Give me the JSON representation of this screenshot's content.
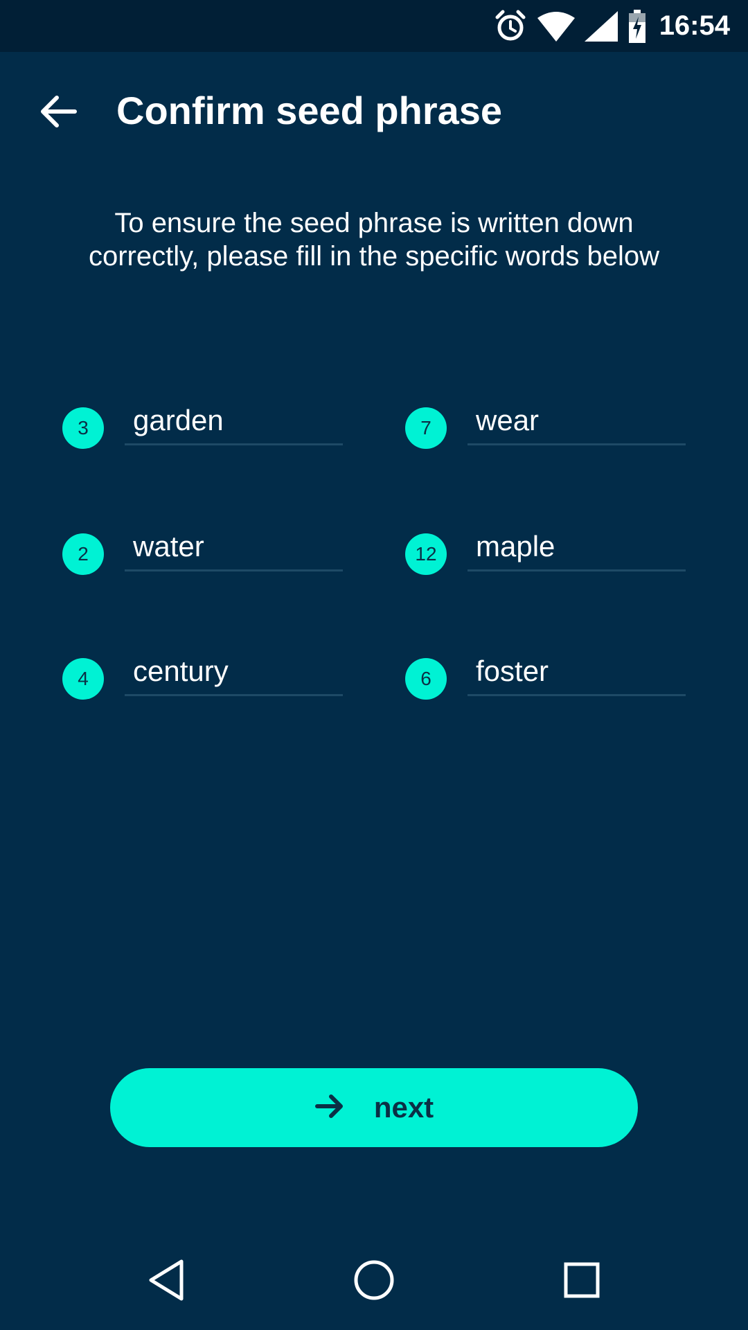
{
  "status_bar": {
    "time": "16:54",
    "icons": [
      "alarm-icon",
      "wifi-icon",
      "signal-icon",
      "battery-charging-icon"
    ]
  },
  "app_bar": {
    "title": "Confirm seed phrase",
    "back_icon": "arrow-left-icon"
  },
  "instructions": "To ensure the seed phrase is written down correctly, please fill in the specific words below",
  "words": [
    {
      "index": "3",
      "value": "garden"
    },
    {
      "index": "7",
      "value": "wear"
    },
    {
      "index": "2",
      "value": "water"
    },
    {
      "index": "12",
      "value": "maple"
    },
    {
      "index": "4",
      "value": "century"
    },
    {
      "index": "6",
      "value": "foster"
    }
  ],
  "next_button": {
    "label": "next",
    "icon": "arrow-right-icon"
  },
  "nav_bar": {
    "icons": [
      "back-triangle-icon",
      "home-circle-icon",
      "recents-square-icon"
    ]
  },
  "colors": {
    "background": "#022c49",
    "status_bar": "#011f36",
    "accent": "#00f2d4",
    "underline": "#1e4a66",
    "on_accent": "#0b2f45"
  }
}
